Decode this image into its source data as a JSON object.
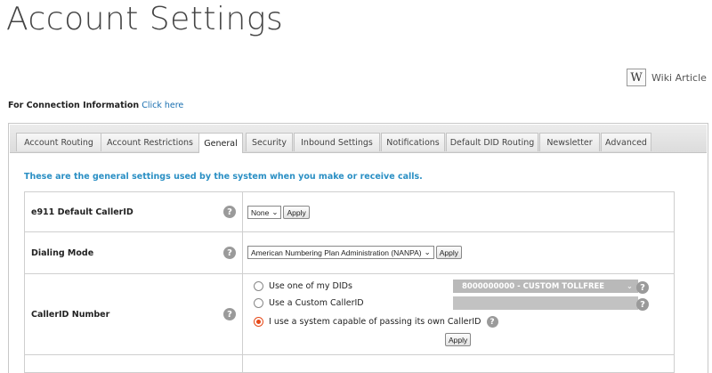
{
  "page_title": "Account Settings",
  "wiki": {
    "icon": "W",
    "label": "Wiki Article"
  },
  "connection": {
    "label": "For Connection Information",
    "link": "Click here"
  },
  "tabs": [
    {
      "label": "Account Routing"
    },
    {
      "label": "Account Restrictions"
    },
    {
      "label": "General",
      "active": true
    },
    {
      "label": "Security"
    },
    {
      "label": "Inbound Settings"
    },
    {
      "label": "Notifications"
    },
    {
      "label": "Default DID Routing"
    },
    {
      "label": "Newsletter"
    },
    {
      "label": "Advanced"
    }
  ],
  "intro": "These are the general settings used by the system when you make or receive calls.",
  "rows": {
    "e911": {
      "label": "e911 Default CallerID",
      "select_value": "None",
      "apply": "Apply"
    },
    "dialing": {
      "label": "Dialing Mode",
      "select_value": "American Numbering Plan Administration (NANPA)",
      "apply": "Apply"
    },
    "callerid": {
      "label": "CallerID Number",
      "option_dids": "Use one of my DIDs",
      "did_value": "8000000000 - CUSTOM TOLLFREE",
      "option_custom": "Use a Custom CallerID",
      "custom_value": "",
      "option_system": "I use a system capable of passing its own CallerID",
      "selected": "system",
      "apply": "Apply"
    }
  },
  "help_glyph": "?",
  "chevron": "⌄"
}
